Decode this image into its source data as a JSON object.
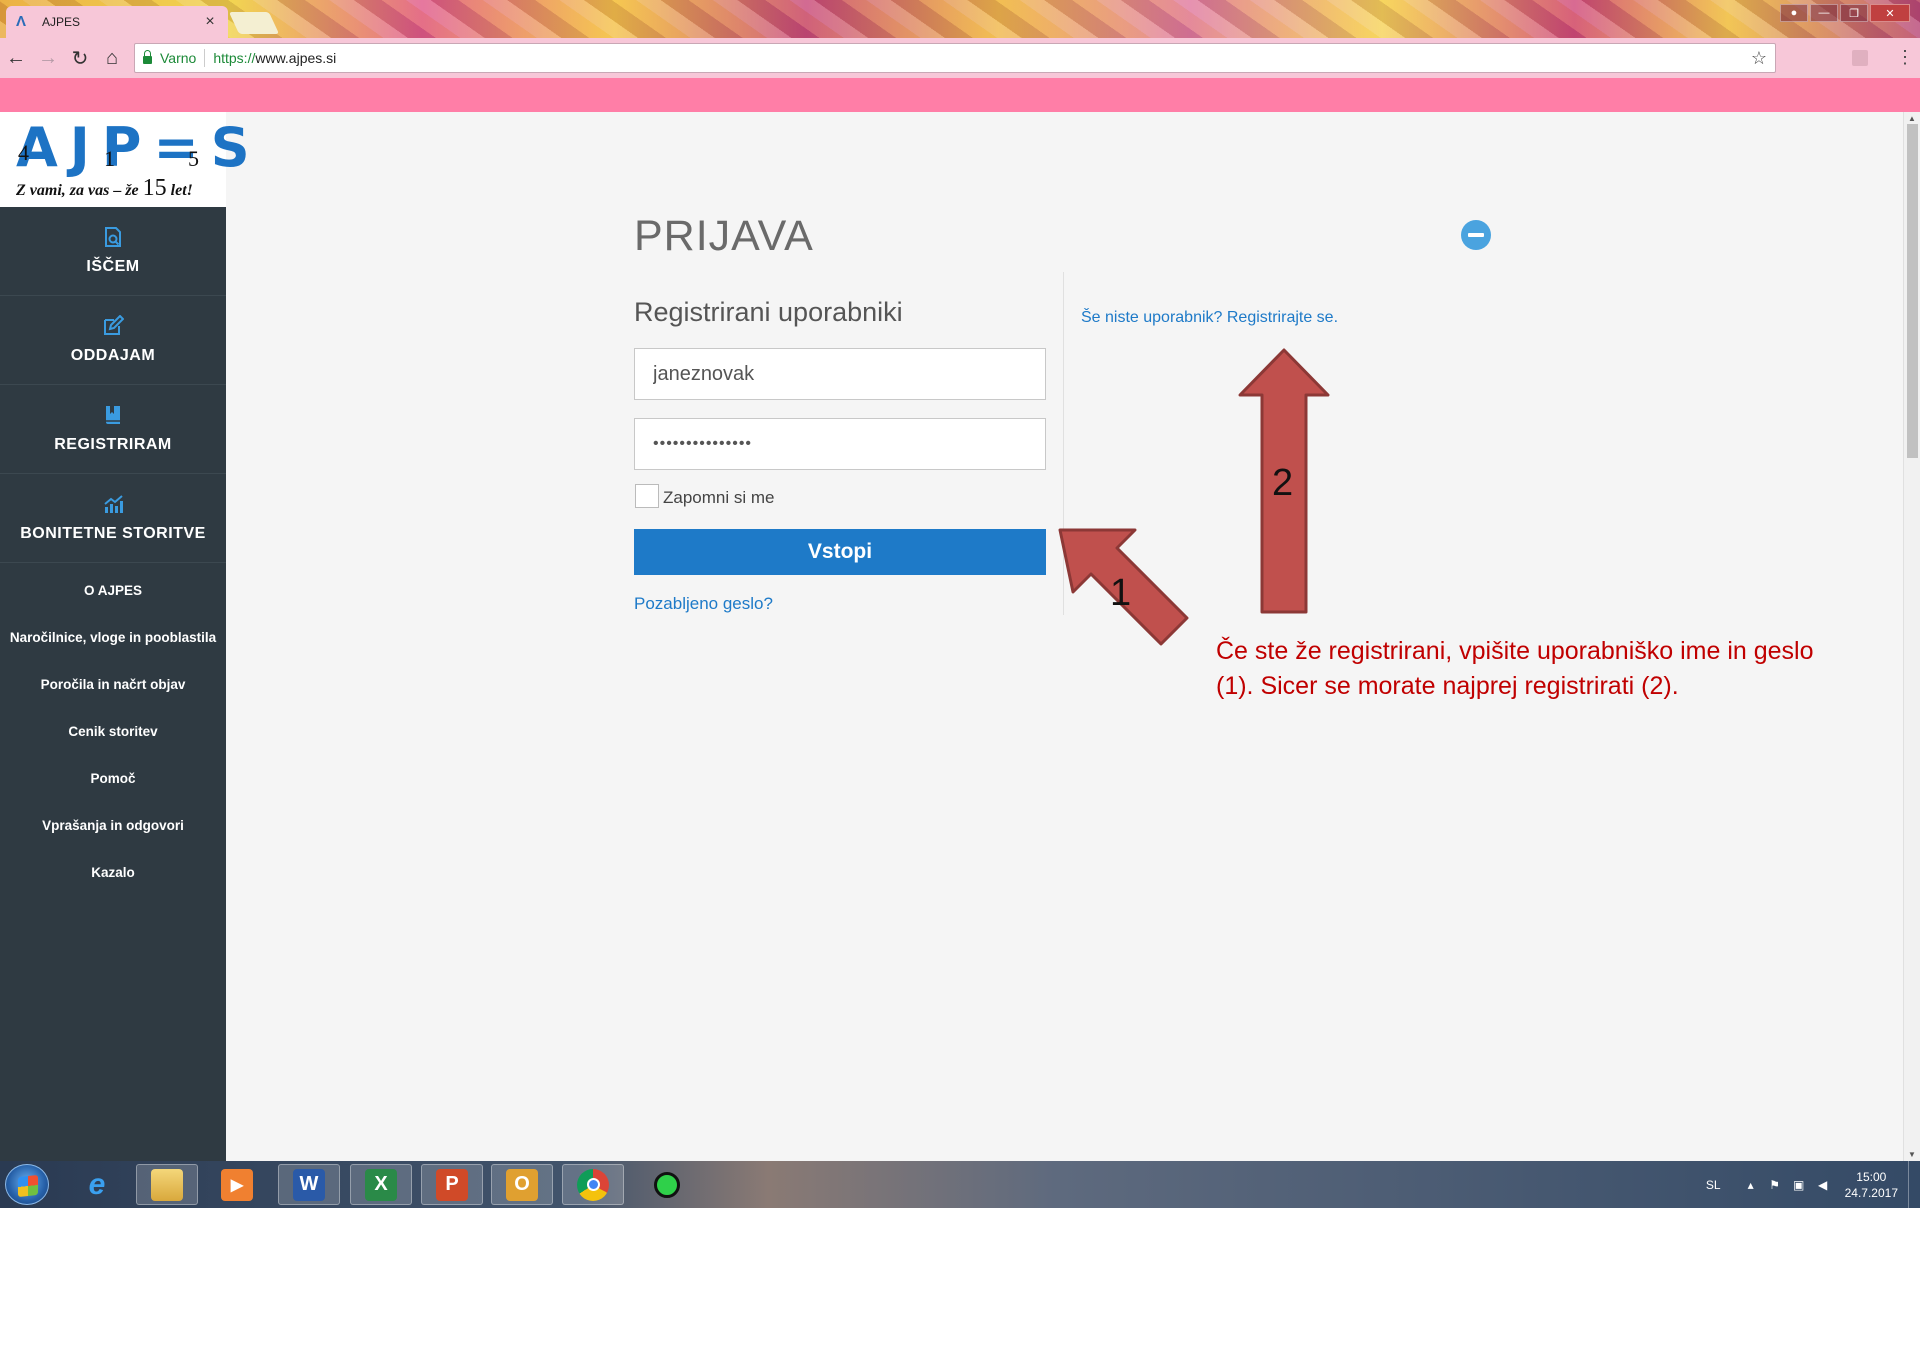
{
  "browser": {
    "tab_title": "AJPES",
    "secure_label": "Varno",
    "url_scheme": "https://",
    "url_host": "www.ajpes.si"
  },
  "logo": {
    "slogan_prefix": "Z vami, za vas – že ",
    "slogan_number": "15",
    "slogan_suffix": " let!",
    "digits": [
      "4",
      "1",
      "5"
    ]
  },
  "sidebar": {
    "main_items": [
      {
        "label": "IŠČEM",
        "icon": "search-document-icon"
      },
      {
        "label": "ODDAJAM",
        "icon": "edit-icon"
      },
      {
        "label": "REGISTRIRAM",
        "icon": "book-icon"
      },
      {
        "label": "BONITETNE STORITVE",
        "icon": "chart-icon"
      }
    ],
    "sub_items": [
      {
        "label": "O AJPES"
      },
      {
        "label": "Naročilnice, vloge in pooblastila"
      },
      {
        "label": "Poročila in načrt objav"
      },
      {
        "label": "Cenik storitev"
      },
      {
        "label": "Pomoč"
      },
      {
        "label": "Vprašanja in odgovori"
      },
      {
        "label": "Kazalo"
      }
    ]
  },
  "login": {
    "title": "PRIJAVA",
    "subtitle": "Registrirani uporabniki",
    "username_value": "janeznovak",
    "password_value": "•••••••••••••••",
    "remember_label": "Zapomni si me",
    "submit_label": "Vstopi",
    "forgot_label": "Pozabljeno geslo?",
    "register_label": "Še niste uporabnik? Registrirajte se."
  },
  "annotation": {
    "marker_1": "1",
    "marker_2": "2",
    "text": "Če ste že registrirani, vpišite uporabniško ime in geslo (1). Sicer se morate najprej registrirati (2).",
    "color": "#c00000"
  },
  "taskbar": {
    "apps": [
      {
        "name": "internet-explorer-icon",
        "glyph": "e"
      },
      {
        "name": "file-explorer-icon",
        "glyph": ""
      },
      {
        "name": "media-player-icon",
        "glyph": "▶"
      },
      {
        "name": "word-icon",
        "glyph": "W"
      },
      {
        "name": "excel-icon",
        "glyph": "X"
      },
      {
        "name": "powerpoint-icon",
        "glyph": "P"
      },
      {
        "name": "outlook-icon",
        "glyph": "O"
      },
      {
        "name": "chrome-icon",
        "glyph": ""
      }
    ],
    "language": "SL",
    "time": "15:00",
    "date": "24.7.2017"
  },
  "colors": {
    "sidebar": "#2f3a42",
    "accent": "#1e7ac8",
    "pink_band": "#ff7ea7"
  }
}
